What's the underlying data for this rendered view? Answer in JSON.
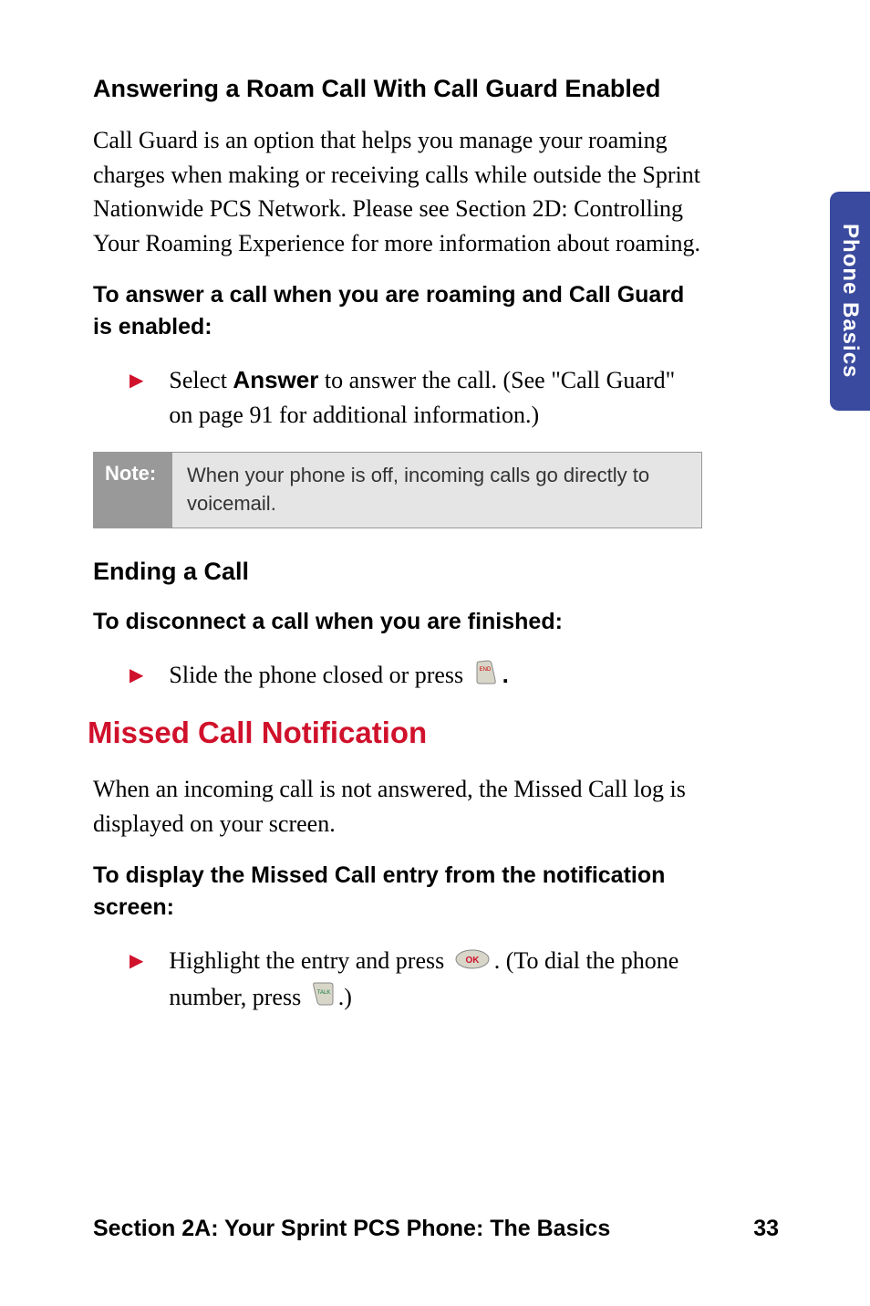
{
  "side_tab": "Phone Basics",
  "sections": {
    "heading1": "Answering a Roam Call With Call Guard Enabled",
    "para1": "Call Guard is an option that helps you manage your roaming charges when making or receiving calls while outside the Sprint Nationwide PCS Network. Please see Section 2D: Controlling Your Roaming Experience for more information about roaming.",
    "instruction1": "To answer a call when you are roaming and Call Guard is enabled:",
    "bullet1_prefix": "Select ",
    "bullet1_bold": "Answer",
    "bullet1_suffix": " to answer the call. (See \"Call Guard\" on page 91 for additional information.)",
    "note_label": "Note:",
    "note_text": "When your phone is off, incoming calls go directly to voicemail.",
    "heading2": "Ending a Call",
    "instruction2": "To disconnect a call when you are finished:",
    "bullet2_prefix": "Slide the phone closed or press ",
    "bullet2_suffix": ".",
    "heading3": "Missed Call Notification",
    "para3": "When an incoming call is not answered, the Missed Call log is displayed on your screen.",
    "instruction3": "To display the Missed Call entry from the notification screen:",
    "bullet3_prefix": "Highlight the entry and press ",
    "bullet3_middle": ". (To dial the phone number, press ",
    "bullet3_suffix": ".)"
  },
  "footer": {
    "section_label": "Section 2A: Your Sprint PCS Phone: The Basics",
    "page_number": "33"
  }
}
